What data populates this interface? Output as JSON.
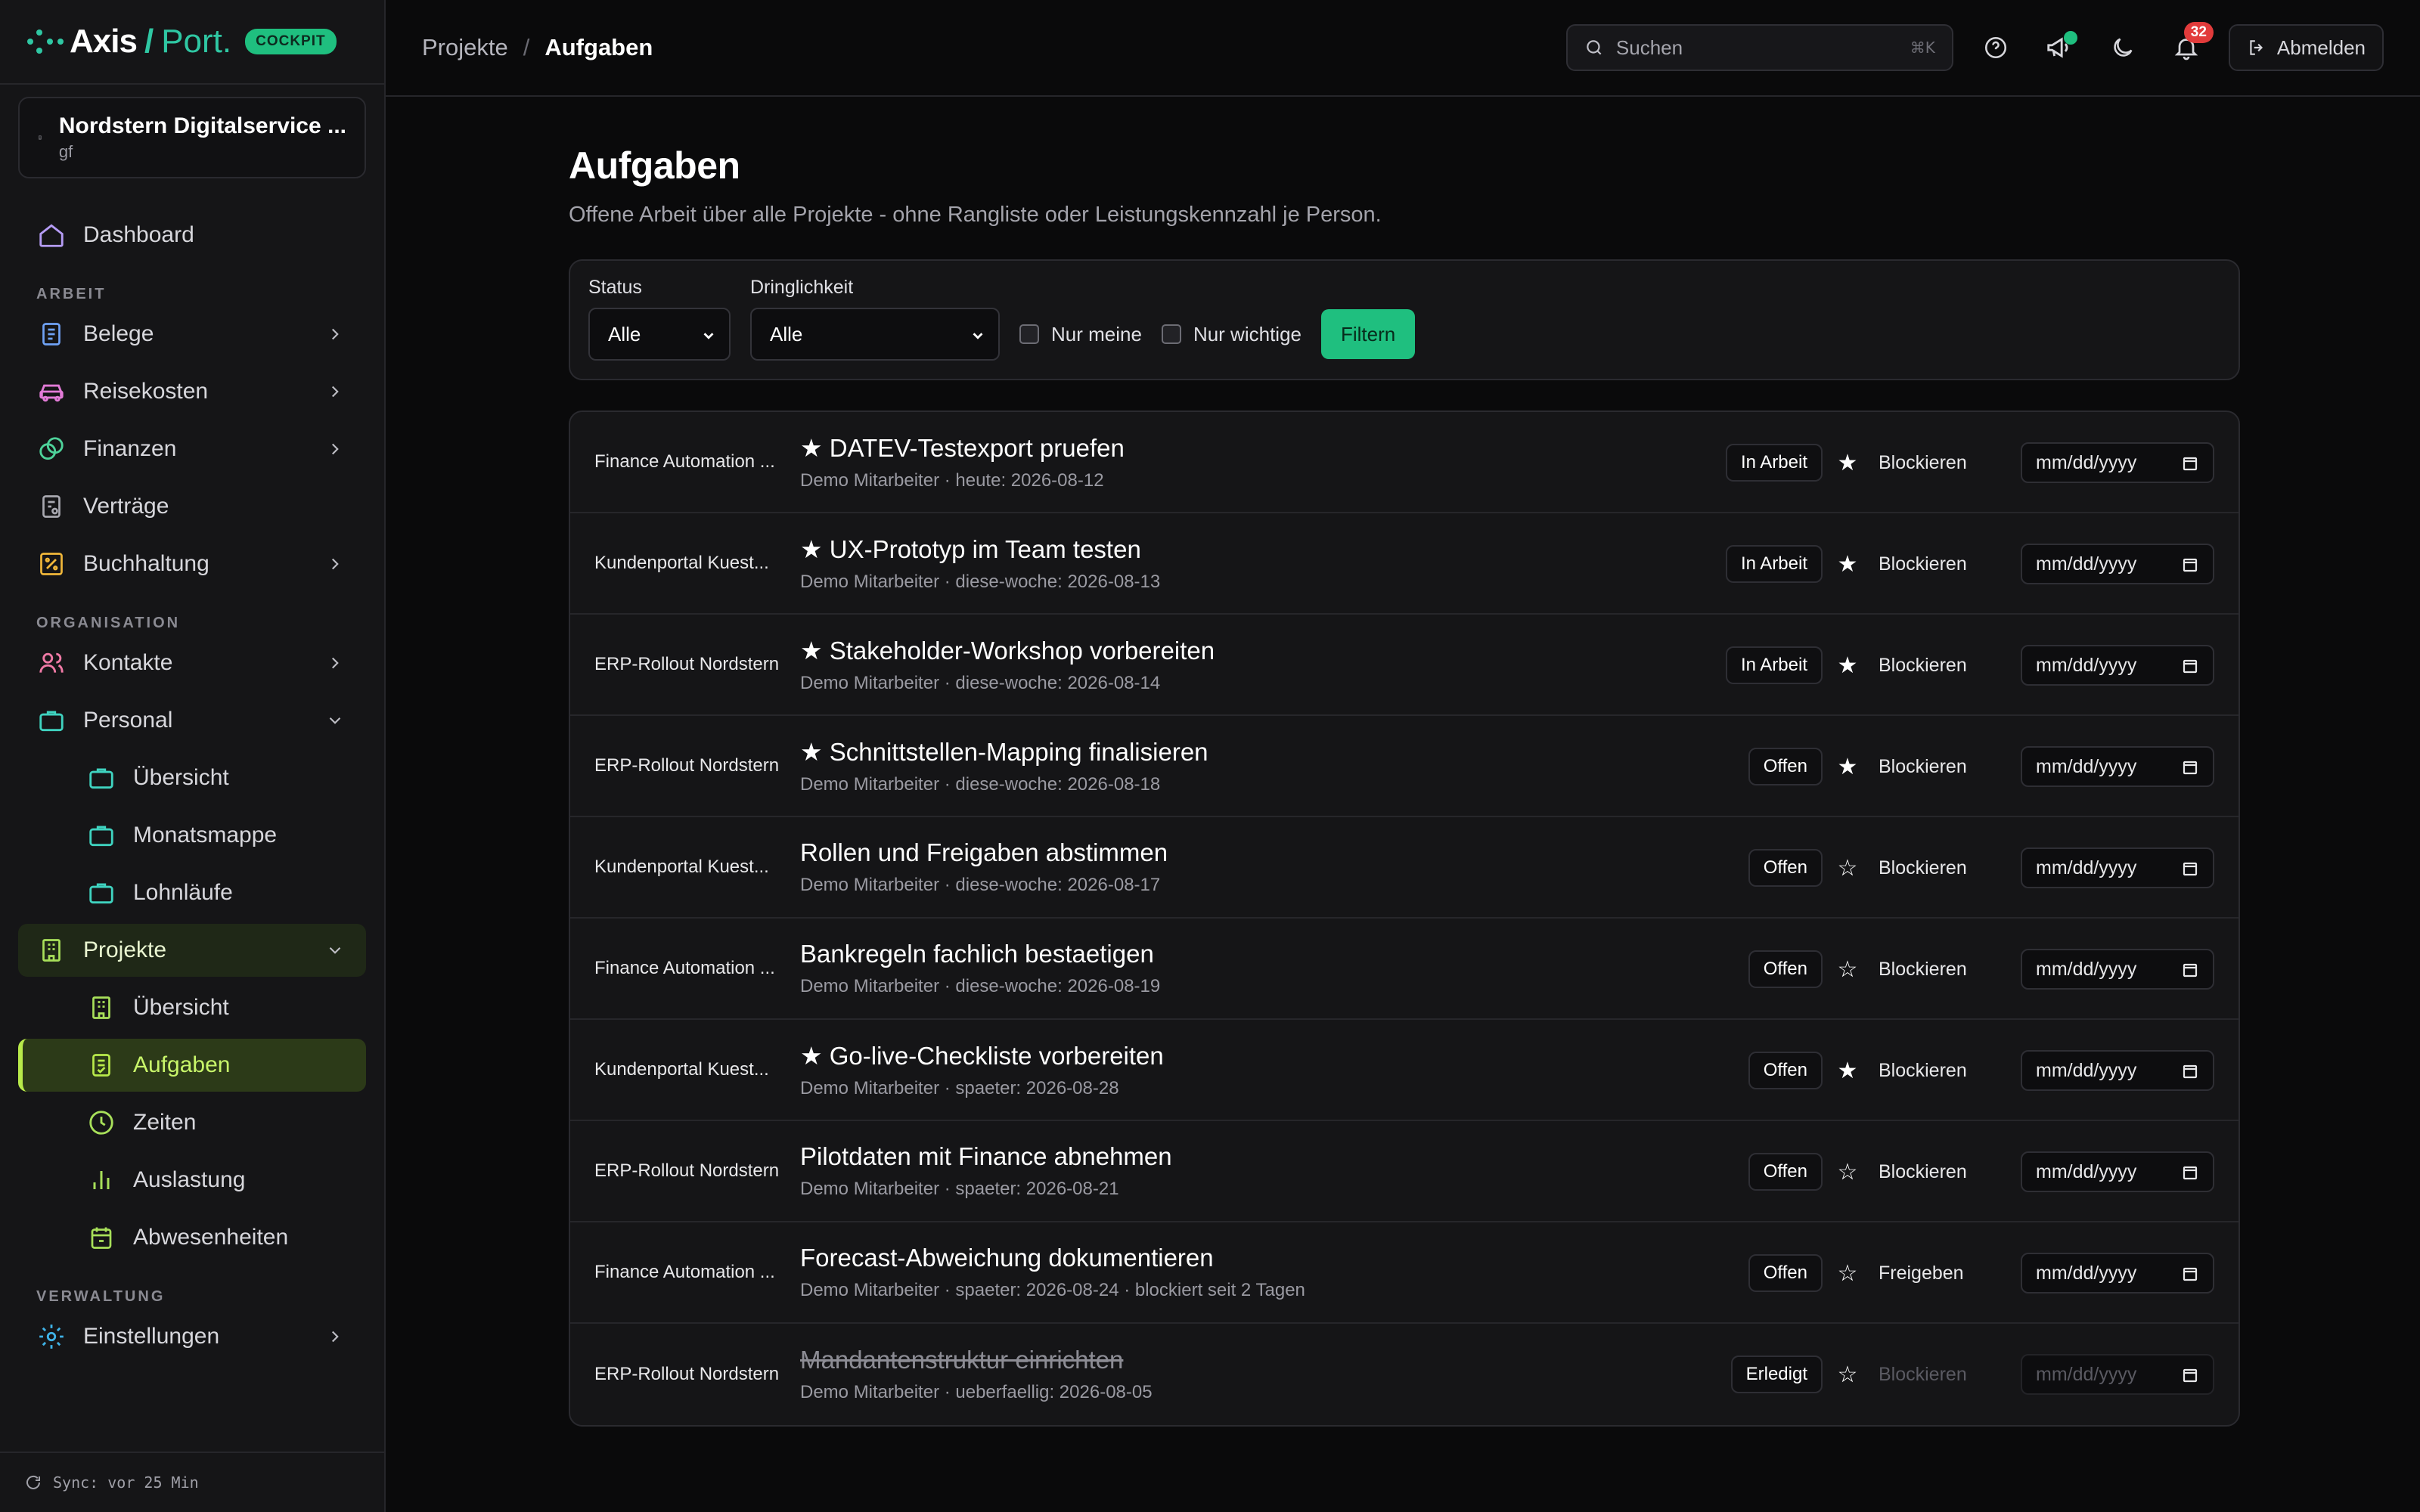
{
  "brand": {
    "name": "Axis",
    "slash": "/",
    "port": "Port.",
    "badge": "COCKPIT"
  },
  "org": {
    "name": "Nordstern Digitalservice ...",
    "sub": "gf"
  },
  "nav": {
    "dashboard": "Dashboard",
    "section_arbeit": "ARBEIT",
    "belege": "Belege",
    "reisekosten": "Reisekosten",
    "finanzen": "Finanzen",
    "vertraege": "Verträge",
    "buchhaltung": "Buchhaltung",
    "section_organisation": "ORGANISATION",
    "kontakte": "Kontakte",
    "personal": "Personal",
    "personal_sub": [
      "Übersicht",
      "Monatsmappe",
      "Lohnläufe"
    ],
    "projekte": "Projekte",
    "projekte_sub": [
      "Übersicht",
      "Aufgaben",
      "Zeiten",
      "Auslastung",
      "Abwesenheiten"
    ],
    "section_verwaltung": "VERWALTUNG",
    "einstellungen": "Einstellungen"
  },
  "sync": "Sync: vor 25 Min",
  "breadcrumb": {
    "parent": "Projekte",
    "sep": "/",
    "current": "Aufgaben"
  },
  "search": {
    "placeholder": "Suchen",
    "shortcut": "⌘K"
  },
  "notifications": {
    "count": "32"
  },
  "logout": "Abmelden",
  "page": {
    "title": "Aufgaben",
    "subtitle": "Offene Arbeit über alle Projekte - ohne Rangliste oder Leistungskennzahl je Person."
  },
  "filters": {
    "status_label": "Status",
    "status_value": "Alle",
    "urgency_label": "Dringlichkeit",
    "urgency_value": "Alle",
    "only_mine": "Nur meine",
    "only_important": "Nur wichtige",
    "submit": "Filtern"
  },
  "tasks": [
    {
      "project": "Finance Automation ...",
      "title": "★ DATEV-Testexport pruefen",
      "meta": "Demo Mitarbeiter · heute: 2026-08-12",
      "status": "In Arbeit",
      "star": "★",
      "action": "Blockieren",
      "date": "mm/dd/yyyy"
    },
    {
      "project": "Kundenportal Kuest...",
      "title": "★ UX-Prototyp im Team testen",
      "meta": "Demo Mitarbeiter · diese-woche: 2026-08-13",
      "status": "In Arbeit",
      "star": "★",
      "action": "Blockieren",
      "date": "mm/dd/yyyy"
    },
    {
      "project": "ERP-Rollout Nordstern",
      "title": "★ Stakeholder-Workshop vorbereiten",
      "meta": "Demo Mitarbeiter · diese-woche: 2026-08-14",
      "status": "In Arbeit",
      "star": "★",
      "action": "Blockieren",
      "date": "mm/dd/yyyy"
    },
    {
      "project": "ERP-Rollout Nordstern",
      "title": "★ Schnittstellen-Mapping finalisieren",
      "meta": "Demo Mitarbeiter · diese-woche: 2026-08-18",
      "status": "Offen",
      "star": "★",
      "action": "Blockieren",
      "date": "mm/dd/yyyy"
    },
    {
      "project": "Kundenportal Kuest...",
      "title": "Rollen und Freigaben abstimmen",
      "meta": "Demo Mitarbeiter · diese-woche: 2026-08-17",
      "status": "Offen",
      "star": "☆",
      "action": "Blockieren",
      "date": "mm/dd/yyyy"
    },
    {
      "project": "Finance Automation ...",
      "title": "Bankregeln fachlich bestaetigen",
      "meta": "Demo Mitarbeiter · diese-woche: 2026-08-19",
      "status": "Offen",
      "star": "☆",
      "action": "Blockieren",
      "date": "mm/dd/yyyy"
    },
    {
      "project": "Kundenportal Kuest...",
      "title": "★ Go-live-Checkliste vorbereiten",
      "meta": "Demo Mitarbeiter · spaeter: 2026-08-28",
      "status": "Offen",
      "star": "★",
      "action": "Blockieren",
      "date": "mm/dd/yyyy"
    },
    {
      "project": "ERP-Rollout Nordstern",
      "title": "Pilotdaten mit Finance abnehmen",
      "meta": "Demo Mitarbeiter · spaeter: 2026-08-21",
      "status": "Offen",
      "star": "☆",
      "action": "Blockieren",
      "date": "mm/dd/yyyy"
    },
    {
      "project": "Finance Automation ...",
      "title": "Forecast-Abweichung dokumentieren",
      "meta": "Demo Mitarbeiter · spaeter: 2026-08-24 · blockiert seit 2 Tagen",
      "status": "Offen",
      "star": "☆",
      "action": "Freigeben",
      "date": "mm/dd/yyyy"
    },
    {
      "project": "ERP-Rollout Nordstern",
      "title": "Mandantenstruktur einrichten",
      "meta": "Demo Mitarbeiter · ueberfaellig: 2026-08-05",
      "status": "Erledigt",
      "star": "☆",
      "action": "Blockieren",
      "date": "mm/dd/yyyy"
    }
  ]
}
